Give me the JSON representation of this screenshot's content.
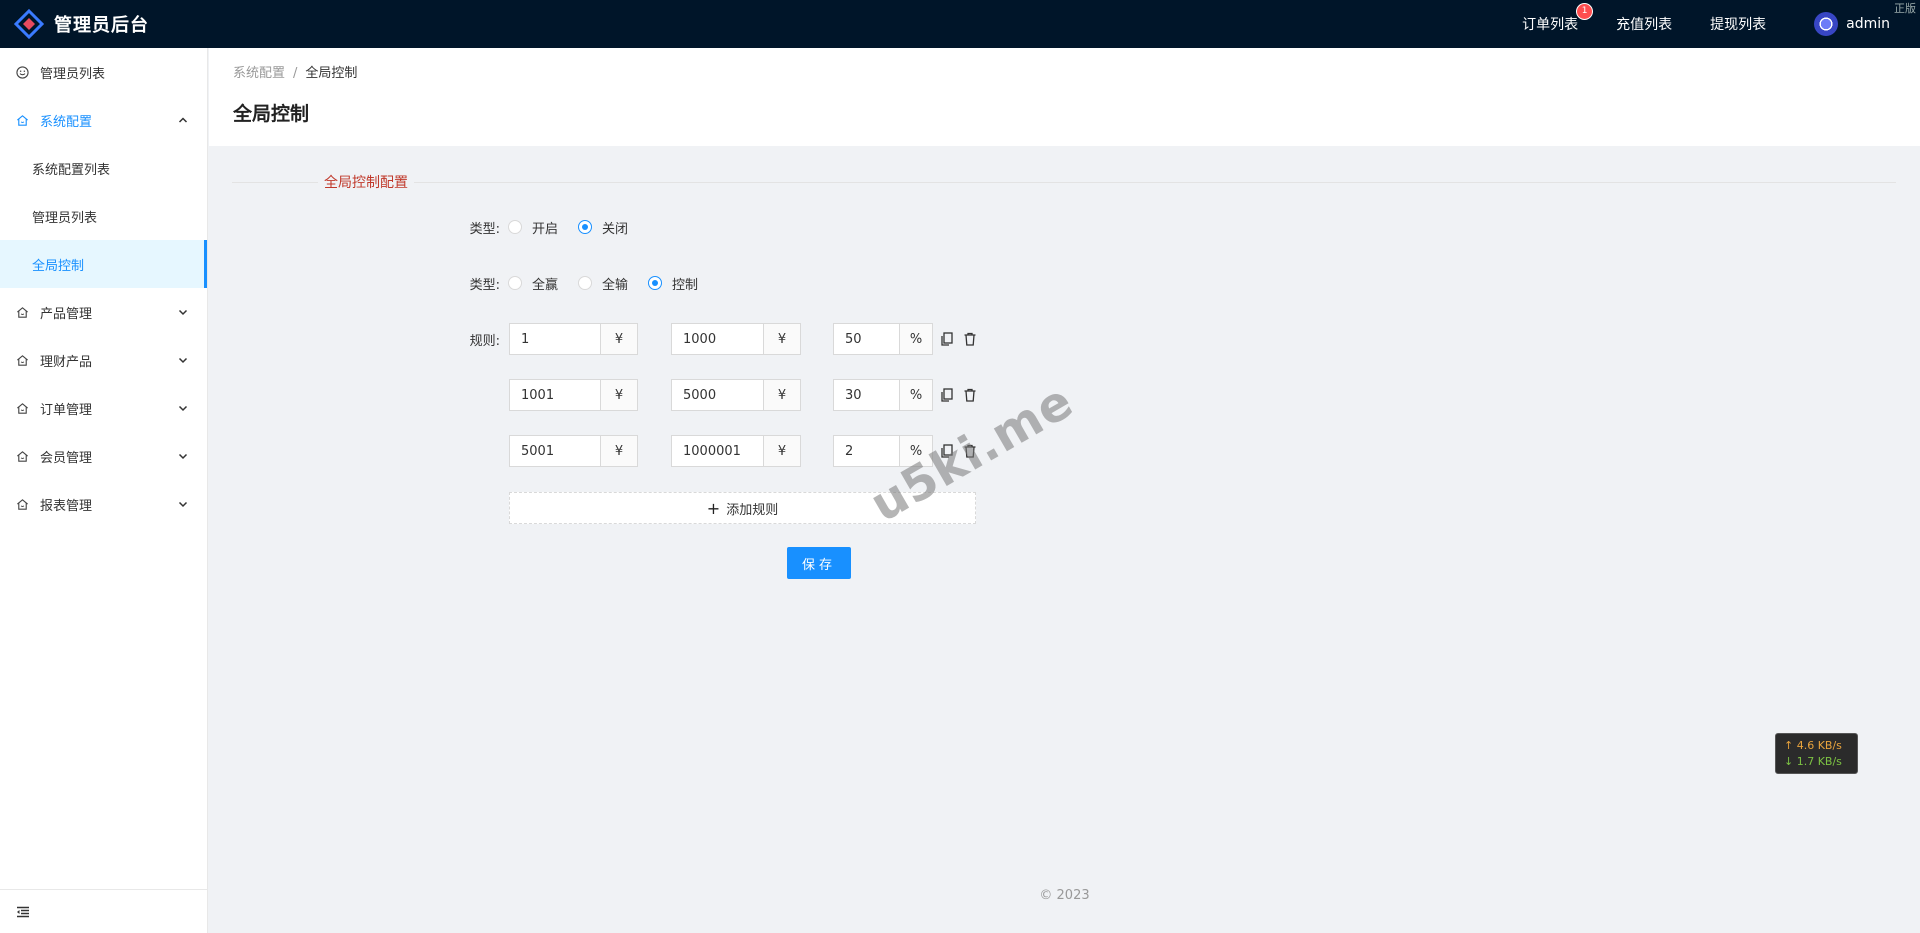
{
  "header": {
    "app_title": "管理员后台",
    "links": [
      {
        "label": "订单列表",
        "badge": "1"
      },
      {
        "label": "充值列表"
      },
      {
        "label": "提现列表"
      }
    ],
    "username": "admin",
    "corner_text": "正版"
  },
  "sidebar": {
    "items": [
      {
        "label": "管理员列表",
        "icon": "smile-icon"
      },
      {
        "label": "系统配置",
        "icon": "home-icon",
        "open": true,
        "children": [
          {
            "label": "系统配置列表"
          },
          {
            "label": "管理员列表"
          },
          {
            "label": "全局控制",
            "active": true
          }
        ]
      },
      {
        "label": "产品管理",
        "icon": "home-icon"
      },
      {
        "label": "理财产品",
        "icon": "home-icon"
      },
      {
        "label": "订单管理",
        "icon": "home-icon"
      },
      {
        "label": "会员管理",
        "icon": "home-icon"
      },
      {
        "label": "报表管理",
        "icon": "home-icon"
      }
    ]
  },
  "breadcrumb": {
    "parent": "系统配置",
    "separator": "/",
    "current": "全局控制"
  },
  "page_title": "全局控制",
  "section_title": "全局控制配置",
  "form": {
    "switch_label": "类型:",
    "switch_options": [
      {
        "label": "开启",
        "checked": false
      },
      {
        "label": "关闭",
        "checked": true
      }
    ],
    "mode_label": "类型:",
    "mode_options": [
      {
        "label": "全赢",
        "checked": false
      },
      {
        "label": "全输",
        "checked": false
      },
      {
        "label": "控制",
        "checked": true
      }
    ],
    "rules_label": "规则:",
    "rules": [
      {
        "min": "1",
        "max": "1000",
        "percent": "50"
      },
      {
        "min": "1001",
        "max": "5000",
        "percent": "30"
      },
      {
        "min": "5001",
        "max": "1000001",
        "percent": "2"
      }
    ],
    "currency_symbol": "¥",
    "percent_symbol": "%",
    "add_rule_label": "添加规则",
    "save_label": "保存"
  },
  "watermark": "u5ki.me",
  "speed": {
    "up": "↑ 4.6 KB/s",
    "down": "↓ 1.7 KB/s"
  },
  "footer": "© 2023",
  "colors": {
    "accent": "#1890ff",
    "header_bg": "#001529",
    "section_title": "#c0392b"
  }
}
